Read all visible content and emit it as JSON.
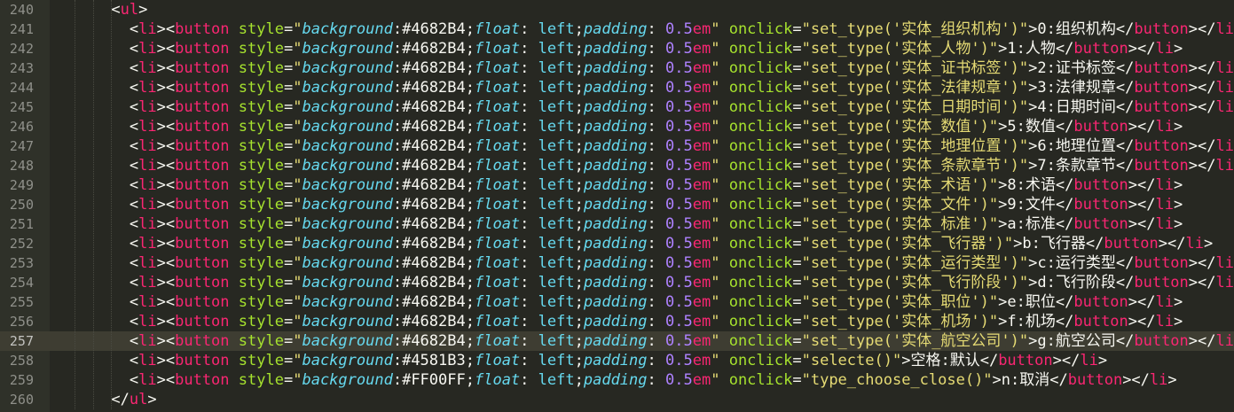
{
  "editor": {
    "theme_colors": {
      "background": "#272822",
      "gutter": "#2F3129",
      "tag": "#F92672",
      "attribute": "#A6E22E",
      "string": "#E6DB74",
      "css_property": "#66D9EF",
      "number": "#AE81FF"
    },
    "current_line": 257,
    "lines": [
      {
        "num": "240",
        "type": "open",
        "indent": 2,
        "tag": "ul"
      },
      {
        "num": "241",
        "type": "item",
        "color": "#4682B4",
        "call": "set_type('实体_组织机构')",
        "label": "0:组织机构"
      },
      {
        "num": "242",
        "type": "item",
        "color": "#4682B4",
        "call": "set_type('实体_人物')",
        "label": "1:人物"
      },
      {
        "num": "243",
        "type": "item",
        "color": "#4682B4",
        "call": "set_type('实体_证书标签')",
        "label": "2:证书标签"
      },
      {
        "num": "244",
        "type": "item",
        "color": "#4682B4",
        "call": "set_type('实体_法律规章')",
        "label": "3:法律规章"
      },
      {
        "num": "245",
        "type": "item",
        "color": "#4682B4",
        "call": "set_type('实体_日期时间')",
        "label": "4:日期时间"
      },
      {
        "num": "246",
        "type": "item",
        "color": "#4682B4",
        "call": "set_type('实体_数值')",
        "label": "5:数值"
      },
      {
        "num": "247",
        "type": "item",
        "color": "#4682B4",
        "call": "set_type('实体_地理位置')",
        "label": "6:地理位置"
      },
      {
        "num": "248",
        "type": "item",
        "color": "#4682B4",
        "call": "set_type('实体_条款章节')",
        "label": "7:条款章节"
      },
      {
        "num": "249",
        "type": "item",
        "color": "#4682B4",
        "call": "set_type('实体_术语')",
        "label": "8:术语"
      },
      {
        "num": "250",
        "type": "item",
        "color": "#4682B4",
        "call": "set_type('实体_文件')",
        "label": "9:文件"
      },
      {
        "num": "251",
        "type": "item",
        "color": "#4682B4",
        "call": "set_type('实体_标准')",
        "label": "a:标准"
      },
      {
        "num": "252",
        "type": "item",
        "color": "#4682B4",
        "call": "set_type('实体_飞行器')",
        "label": "b:飞行器"
      },
      {
        "num": "253",
        "type": "item",
        "color": "#4682B4",
        "call": "set_type('实体_运行类型')",
        "label": "c:运行类型"
      },
      {
        "num": "254",
        "type": "item",
        "color": "#4682B4",
        "call": "set_type('实体_飞行阶段')",
        "label": "d:飞行阶段"
      },
      {
        "num": "255",
        "type": "item",
        "color": "#4682B4",
        "call": "set_type('实体_职位')",
        "label": "e:职位"
      },
      {
        "num": "256",
        "type": "item",
        "color": "#4682B4",
        "call": "set_type('实体_机场')",
        "label": "f:机场"
      },
      {
        "num": "257",
        "type": "item",
        "color": "#4682B4",
        "call": "set_type('实体_航空公司')",
        "label": "g:航空公司"
      },
      {
        "num": "258",
        "type": "item",
        "color": "#4581B3",
        "call": "selecte()",
        "label": "空格:默认"
      },
      {
        "num": "259",
        "type": "item",
        "color": "#FF00FF",
        "call": "type_choose_close()",
        "label": "n:取消"
      },
      {
        "num": "260",
        "type": "close",
        "indent": 2,
        "tag": "ul"
      }
    ]
  }
}
